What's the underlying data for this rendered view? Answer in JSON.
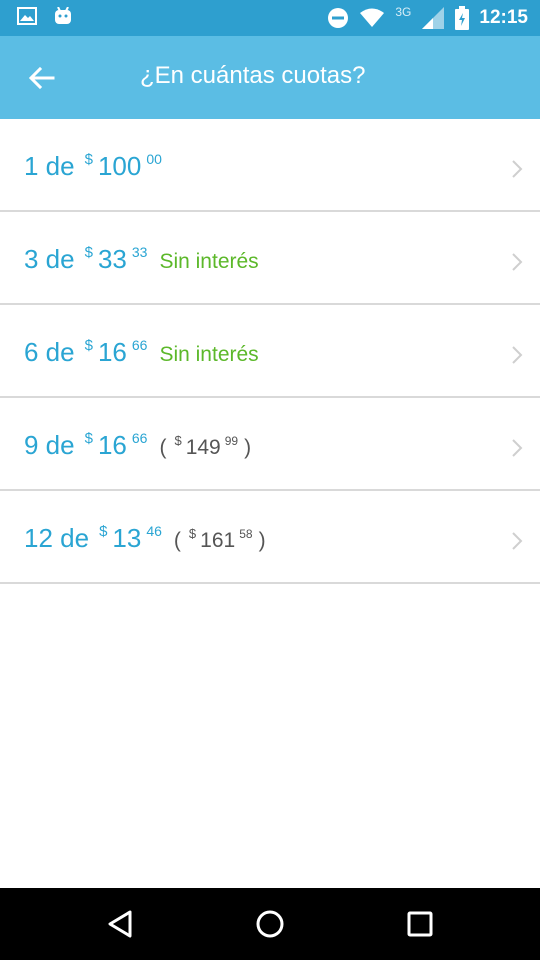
{
  "status_bar": {
    "time": "12:15",
    "network": "3G",
    "icons": [
      "image-icon",
      "android-icon",
      "dnd-icon",
      "wifi-icon",
      "signal-icon",
      "battery-icon"
    ]
  },
  "app_bar": {
    "title": "¿En cuántas cuotas?",
    "back_icon": "arrow-left-icon"
  },
  "installments": [
    {
      "count": "1 de",
      "currency": "$",
      "int": "100",
      "dec": "00",
      "interest_label": "",
      "total": null
    },
    {
      "count": "3 de",
      "currency": "$",
      "int": "33",
      "dec": "33",
      "interest_label": "Sin interés",
      "total": null
    },
    {
      "count": "6 de",
      "currency": "$",
      "int": "16",
      "dec": "66",
      "interest_label": "Sin interés",
      "total": null
    },
    {
      "count": "9 de",
      "currency": "$",
      "int": "16",
      "dec": "66",
      "interest_label": "",
      "total": {
        "open": "(",
        "currency": "$",
        "int": "149",
        "dec": "99",
        "close": ")"
      }
    },
    {
      "count": "12 de",
      "currency": "$",
      "int": "13",
      "dec": "46",
      "interest_label": "",
      "total": {
        "open": "(",
        "currency": "$",
        "int": "161",
        "dec": "58",
        "close": ")"
      }
    }
  ],
  "colors": {
    "status_bar": "#2e9fcf",
    "app_bar": "#5bbde4",
    "amount": "#2aa5d3",
    "no_interest": "#5cb82a",
    "total": "#555555",
    "divider": "#d9d9d9"
  },
  "nav_bar": {
    "icons": [
      "back-triangle-icon",
      "home-circle-icon",
      "recents-square-icon"
    ]
  }
}
